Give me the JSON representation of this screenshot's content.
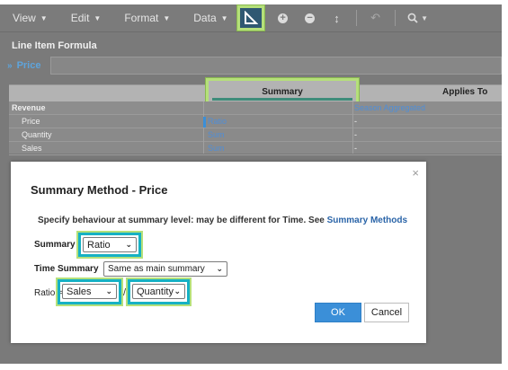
{
  "toolbar": {
    "menus": [
      {
        "label": "View"
      },
      {
        "label": "Edit"
      },
      {
        "label": "Format"
      },
      {
        "label": "Data"
      }
    ]
  },
  "panel": {
    "title": "Line Item Formula",
    "formula_name": "Price"
  },
  "grid": {
    "headers": {
      "summary": "Summary",
      "applies_to": "Applies To"
    },
    "rows": [
      {
        "name": "Revenue",
        "summary": "",
        "applies_to": "Season Aggregated",
        "section": true
      },
      {
        "name": "Price",
        "summary": "Ratio",
        "applies_to": "-"
      },
      {
        "name": "Quantity",
        "summary": "Sum",
        "applies_to": "-"
      },
      {
        "name": "Sales",
        "summary": "Sum",
        "applies_to": "-"
      }
    ]
  },
  "dialog": {
    "close": "×",
    "title": "Summary Method - Price",
    "description": "Specify behaviour at summary level: may be different for Time. See",
    "link": "Summary Methods",
    "summary_label": "Summary",
    "summary_value": "Ratio",
    "time_summary_label": "Time Summary",
    "time_summary_value": "Same as main summary",
    "ratio_label": "Ratio =",
    "ratio_numerator": "Sales",
    "ratio_divider": "/",
    "ratio_denominator": "Quantity",
    "ok_label": "OK",
    "cancel_label": "Cancel"
  },
  "colors": {
    "highlight_green": "#b5e07a",
    "highlight_cyan": "#16b1c4",
    "primary_blue": "#3b8fd8"
  }
}
